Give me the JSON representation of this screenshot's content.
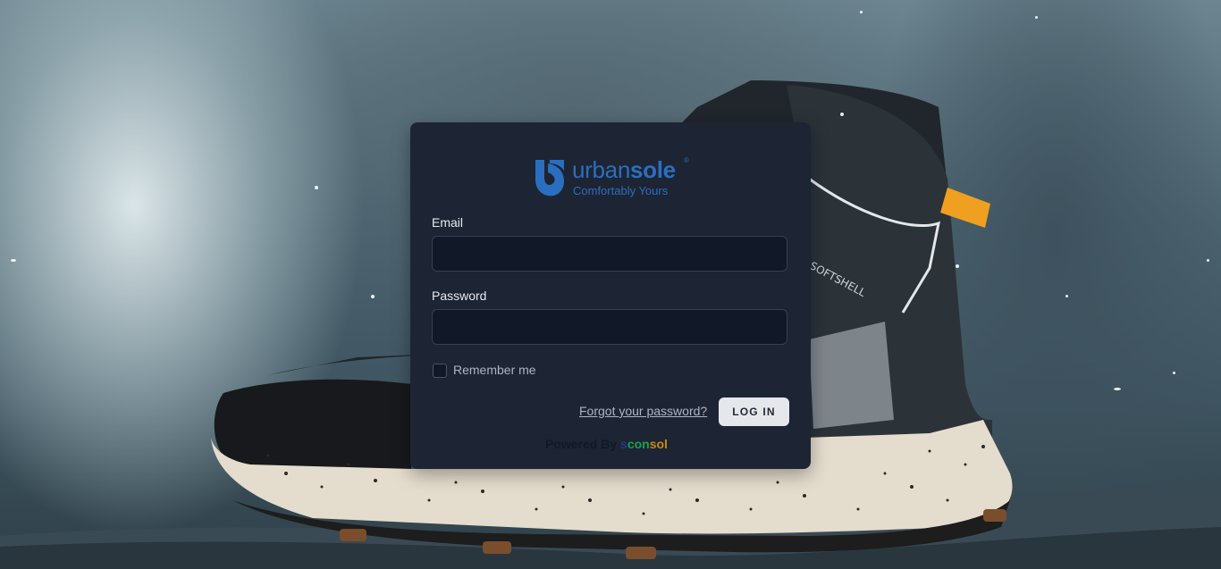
{
  "colors": {
    "card_bg": "#1d2434",
    "brand_blue": "#2a6fbf",
    "input_bg": "#111827",
    "button_bg": "#e5e7eb"
  },
  "logo": {
    "name_light": "urban",
    "name_bold": "sole",
    "registered": "®",
    "tagline": "Comfortably Yours",
    "icon": "urbansole-logo-icon"
  },
  "form": {
    "email_label": "Email",
    "email_value": "",
    "password_label": "Password",
    "password_value": "",
    "remember_label": "Remember me",
    "remember_checked": false,
    "forgot_link": "Forgot your password?",
    "login_button": "LOG IN"
  },
  "footer": {
    "powered_by": "Powered By",
    "brand_a": "s",
    "brand_b": "con",
    "brand_c": "sol"
  }
}
